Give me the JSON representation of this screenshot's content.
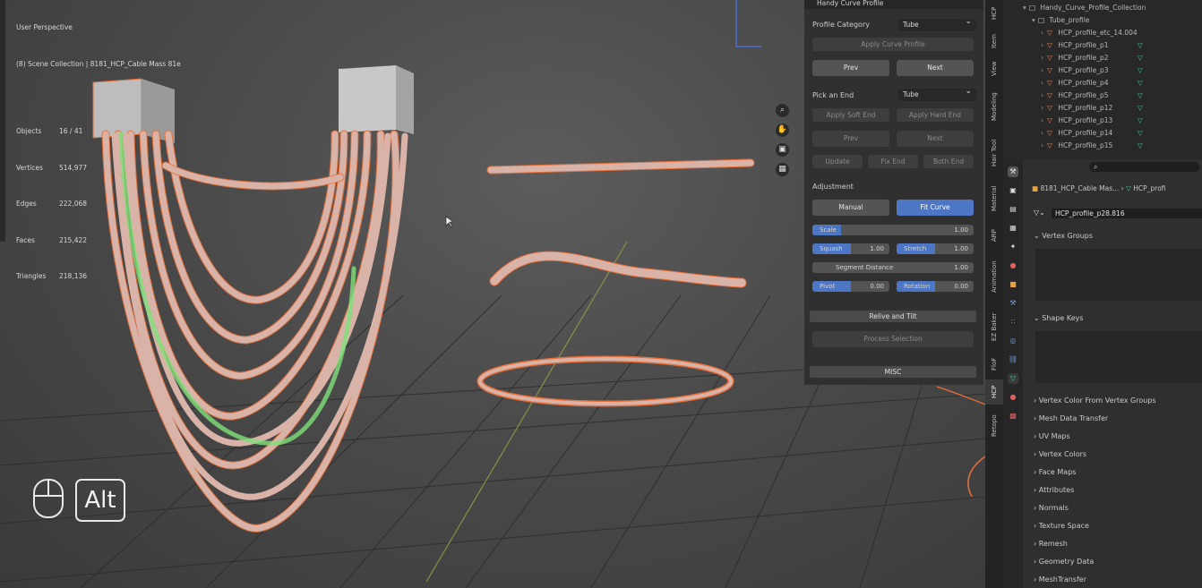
{
  "viewport": {
    "perspective_label": "User Perspective",
    "collection_path": "(8) Scene Collection | 8181_HCP_Cable Mass 81e",
    "stats": [
      {
        "label": "Objects",
        "value": "16 / 41"
      },
      {
        "label": "Vertices",
        "value": "514,977"
      },
      {
        "label": "Edges",
        "value": "222,068"
      },
      {
        "label": "Faces",
        "value": "215,422"
      },
      {
        "label": "Triangles",
        "value": "218,136"
      }
    ],
    "key_hint": "Alt"
  },
  "hcp_panel": {
    "title": "Handy Curve Profile",
    "profile_category_label": "Profile Category",
    "profile_category_value": "Tube",
    "apply_curve_profile": "Apply Curve Profile",
    "prev": "Prev",
    "next": "Next",
    "pick_end_label": "Pick an End",
    "pick_end_value": "Tube",
    "apply_soft_end": "Apply Soft End",
    "apply_hard_end": "Apply Hard End",
    "prev2": "Prev",
    "next2": "Next",
    "update": "Update",
    "fix_end": "Fix End",
    "both_end": "Both End",
    "adjustment_label": "Adjustment",
    "manual": "Manual",
    "fit_curve": "Fit Curve",
    "scale": {
      "label": "Scale",
      "value": "1.00",
      "fill": 0.18
    },
    "squash": {
      "label": "Squash",
      "value": "1.00",
      "fill": 0.5
    },
    "stretch": {
      "label": "Stretch",
      "value": "1.00",
      "fill": 0.5
    },
    "segment_distance": {
      "label": "Segment Distance",
      "value": "1.00"
    },
    "pivot": {
      "label": "Pivot",
      "value": "0.00",
      "fill": 0.5
    },
    "rotation": {
      "label": "Rotation",
      "value": "0.00",
      "fill": 0.5
    },
    "relive_and_tilt": "Relive and Tilt",
    "process_selection": "Process Selection",
    "misc": "MISC"
  },
  "side_tabs": [
    "HCP",
    "Item",
    "View",
    "Modeling",
    "Hair Tool",
    "Material",
    "ARP",
    "Animation",
    "EZ Baker",
    "FloF",
    "HCP",
    "Retopo"
  ],
  "outliner": {
    "rows": [
      {
        "label": "Handy_Curve_Profile_Collection",
        "indent": 1
      },
      {
        "label": "Tube_profile",
        "indent": 2
      },
      {
        "label": "HCP_profile_etc_14.004",
        "indent": 3
      },
      {
        "label": "HCP_profile_p1",
        "indent": 3
      },
      {
        "label": "HCP_profile_p2",
        "indent": 3
      },
      {
        "label": "HCP_profile_p3",
        "indent": 3
      },
      {
        "label": "HCP_profile_p4",
        "indent": 3
      },
      {
        "label": "HCP_profile_p5",
        "indent": 3
      },
      {
        "label": "HCP_profile_p12",
        "indent": 3
      },
      {
        "label": "HCP_profile_p13",
        "indent": 3
      },
      {
        "label": "HCP_profile_p14",
        "indent": 3
      },
      {
        "label": "HCP_profile_p15",
        "indent": 3
      }
    ]
  },
  "properties": {
    "search_placeholder": "",
    "crumb_object": "8181_HCP_Cable Mas...",
    "crumb_mesh": "HCP_profi",
    "mesh_name": "HCP_profile_p28.816",
    "vertex_groups": "Vertex Groups",
    "shape_keys": "Shape Keys",
    "sections": [
      "Vertex Color From Vertex Groups",
      "Mesh Data Transfer",
      "UV Maps",
      "Vertex Colors",
      "Face Maps",
      "Attributes",
      "Normals",
      "Texture Space",
      "Remesh",
      "Geometry Data",
      "MeshTransfer"
    ]
  },
  "colors": {
    "panel_bg": "#303030",
    "accent_blue": "#4d76c4",
    "cable": "#d9b3a8",
    "selection_outline": "#e8703a",
    "highlight_green": "#7fe07a"
  }
}
